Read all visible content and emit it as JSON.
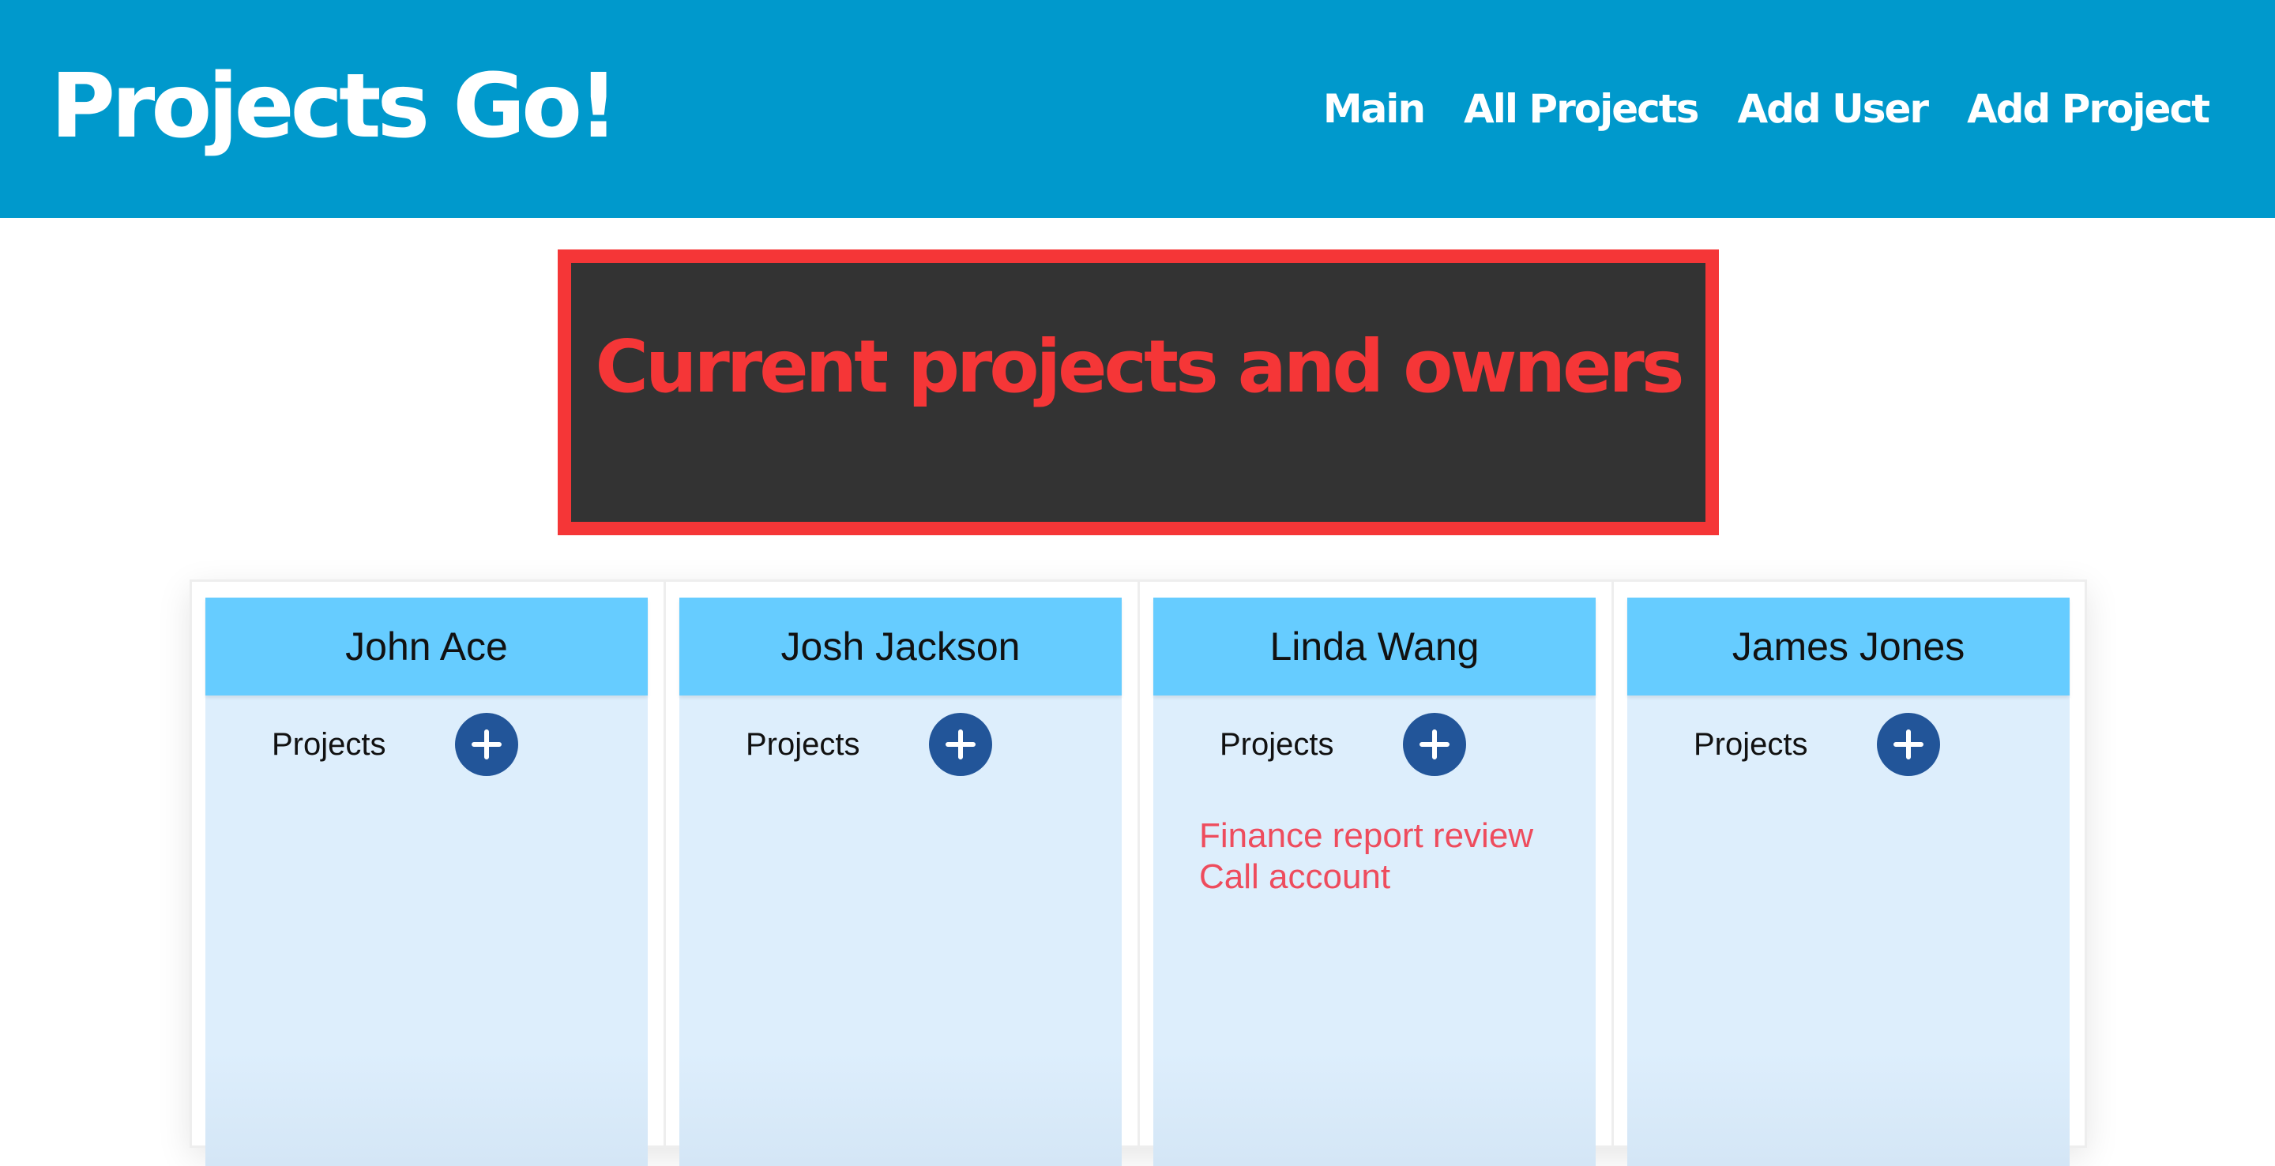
{
  "header": {
    "logo": "Projects Go!",
    "nav": [
      "Main",
      "All Projects",
      "Add User",
      "Add Project"
    ]
  },
  "banner": {
    "title": "Current projects and owners"
  },
  "owners": [
    {
      "name": "John Ace",
      "projects_label": "Projects",
      "projects": []
    },
    {
      "name": "Josh Jackson",
      "projects_label": "Projects",
      "projects": []
    },
    {
      "name": "Linda Wang",
      "projects_label": "Projects",
      "projects": [
        "Finance report review",
        "Call account"
      ]
    },
    {
      "name": "James Jones",
      "projects_label": "Projects",
      "projects": []
    }
  ],
  "icons": {
    "add": "plus-icon"
  },
  "colors": {
    "header_bg": "#0099cc",
    "banner_bg": "#333333",
    "banner_accent": "#f53637",
    "card_header": "#66ccff",
    "card_body": "#ddeefc",
    "add_button": "#225599",
    "project_text": "#ee4c5d"
  }
}
